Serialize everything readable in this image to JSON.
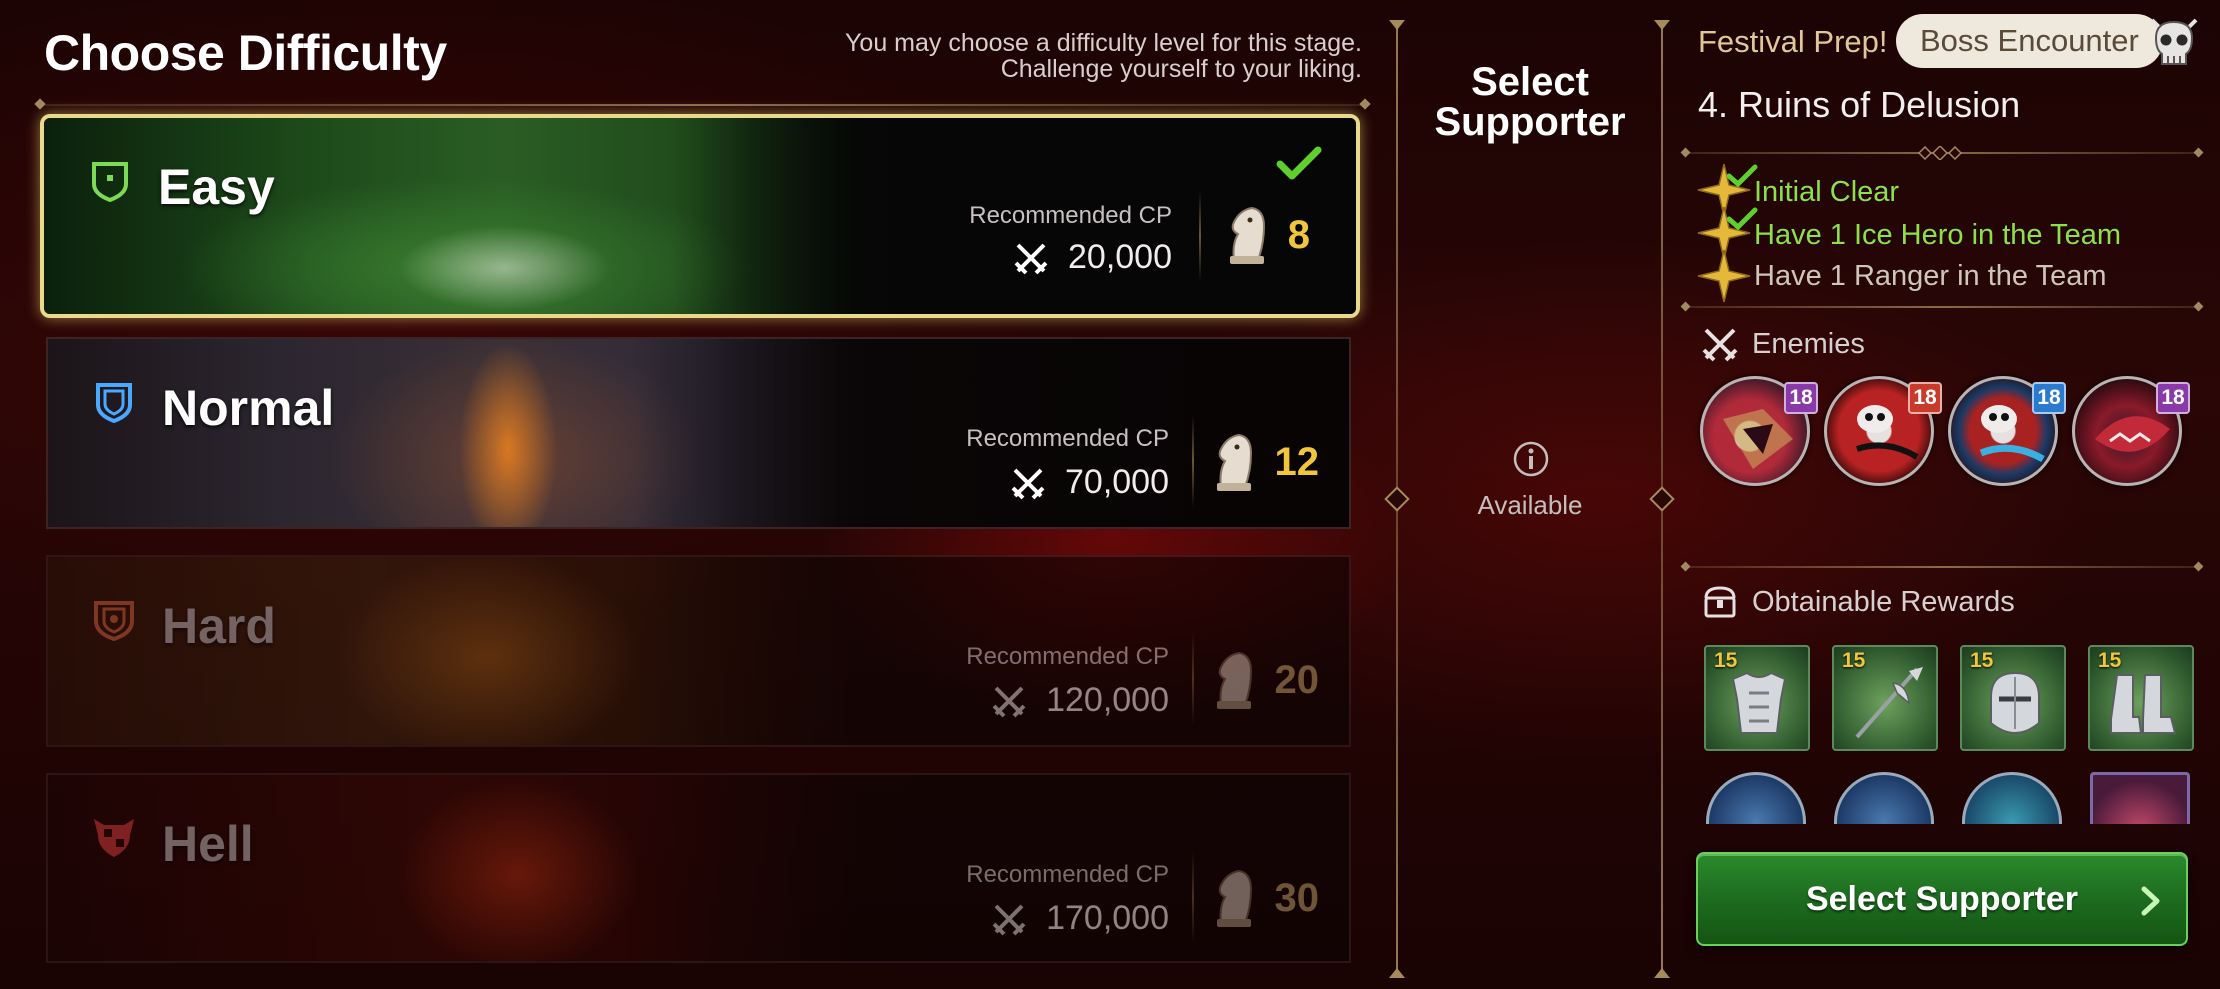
{
  "header": {
    "title": "Choose Difficulty",
    "subtitle": "You may choose a difficulty level for this stage. Challenge yourself to your liking."
  },
  "difficulties": [
    {
      "name": "Easy",
      "rec_label": "Recommended CP",
      "cp": "20,000",
      "stamina": "8",
      "selected": true,
      "icon_color": "#7ed957"
    },
    {
      "name": "Normal",
      "rec_label": "Recommended CP",
      "cp": "70,000",
      "stamina": "12",
      "selected": false,
      "icon_color": "#4aa8ff"
    },
    {
      "name": "Hard",
      "rec_label": "Recommended CP",
      "cp": "120,000",
      "stamina": "20",
      "selected": false,
      "icon_color": "#c8603a"
    },
    {
      "name": "Hell",
      "rec_label": "Recommended CP",
      "cp": "170,000",
      "stamina": "30",
      "selected": false,
      "icon_color": "#d03a3a"
    }
  ],
  "supporter": {
    "title": "Select Supporter",
    "status": "Available"
  },
  "stage": {
    "event_name": "Festival Prep!",
    "badge": "Boss Encounter",
    "name": "4. Ruins of Delusion"
  },
  "missions": [
    {
      "text": "Initial Clear",
      "done": true
    },
    {
      "text": "Have 1 Ice Hero in the Team",
      "done": true
    },
    {
      "text": "Have 1 Ranger in the Team",
      "done": false
    }
  ],
  "enemies": {
    "label": "Enemies",
    "list": [
      {
        "level": "18",
        "badge_color": "#8a3aa8"
      },
      {
        "level": "18",
        "badge_color": "#c83a2a"
      },
      {
        "level": "18",
        "badge_color": "#2a7ad0"
      },
      {
        "level": "18",
        "badge_color": "#8a3aa8"
      }
    ]
  },
  "rewards": {
    "label": "Obtainable Rewards",
    "items": [
      {
        "count": "15",
        "icon": "armor-icon"
      },
      {
        "count": "15",
        "icon": "halberd-icon"
      },
      {
        "count": "15",
        "icon": "helmet-icon"
      },
      {
        "count": "15",
        "icon": "boots-icon"
      }
    ]
  },
  "cta": {
    "label": "Select Supporter"
  },
  "colors": {
    "gold": "#f1c63a",
    "mission_done": "#8ee04a",
    "cta_green": "#1d6c1f",
    "selected_border": "#e9d98a"
  }
}
